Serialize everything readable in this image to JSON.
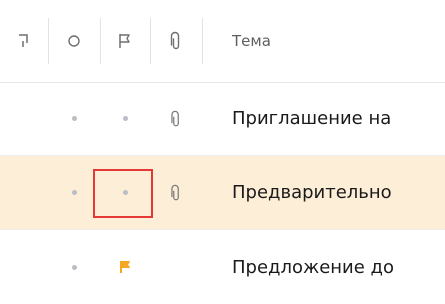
{
  "header": {
    "subject_label": "Тема"
  },
  "rows": [
    {
      "subject": "Приглашение на",
      "has_attachment": true,
      "flagged": false,
      "selected": false
    },
    {
      "subject": "Предварительно",
      "has_attachment": true,
      "flagged": false,
      "selected": true
    },
    {
      "subject": "Предложение до",
      "has_attachment": false,
      "flagged": true,
      "selected": false
    }
  ],
  "colors": {
    "selected_row_background": "#fdeed8",
    "flag_orange": "#f5a623",
    "focus_outline": "#e53935",
    "dot_gray": "#b9bec4"
  }
}
